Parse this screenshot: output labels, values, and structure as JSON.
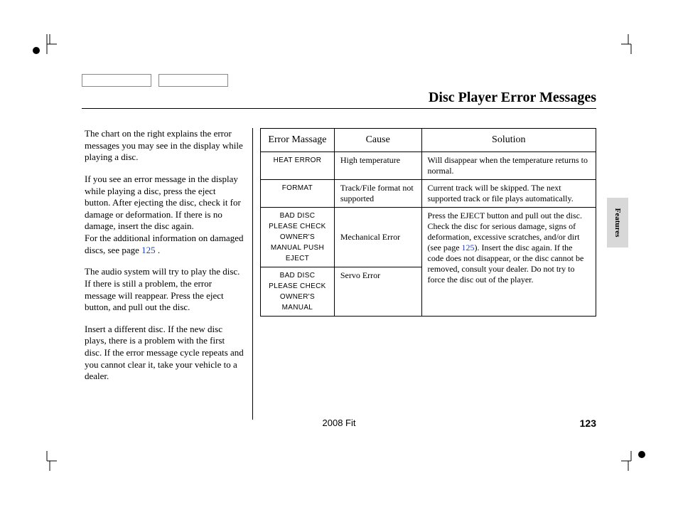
{
  "header": {
    "section_title": "Disc Player Error Messages"
  },
  "side_tab": {
    "label": "Features"
  },
  "footer": {
    "model": "2008  Fit",
    "page_number": "123"
  },
  "body": {
    "paragraphs": {
      "p1": "The chart on the right explains the error messages you may see in the display while playing a disc.",
      "p2a": "If you see an error message in the display while playing a disc, press the eject button. After ejecting the disc, check it for damage or deformation. If there is no damage, insert the disc again.",
      "p2b_prefix": "For the additional information on damaged discs, see page ",
      "p2b_link": "125",
      "p2b_suffix": " .",
      "p3": "The audio system will try to play the disc. If there is still a problem, the error message will reappear. Press the eject button, and pull out the disc.",
      "p4": "Insert a different disc. If the new disc plays, there is a problem with the first disc. If the error message cycle repeats and you cannot clear it, take your vehicle to a dealer."
    }
  },
  "table": {
    "headers": {
      "message": "Error Massage",
      "cause": "Cause",
      "solution": "Solution"
    },
    "rows": [
      {
        "message": "HEAT ERROR",
        "cause": "High temperature",
        "solution": "Will disappear when the temperature returns to normal."
      },
      {
        "message": "FORMAT",
        "cause": "Track/File format not supported",
        "solution": "Current track will be skipped. The next supported track or file plays automatically."
      }
    ],
    "shared": {
      "msg1": "BAD DISC PLEASE CHECK OWNER'S MANUAL PUSH EJECT",
      "cause1": "Mechanical Error",
      "msg2": "BAD DISC PLEASE CHECK OWNER'S MANUAL",
      "cause2": "Servo Error",
      "solution_a": "Press the EJECT button and pull out the disc. Check the disc for serious damage, signs of deformation, excessive scratches, and/or dirt (see page ",
      "solution_link": "125",
      "solution_b": "). Insert the disc again. If the code does not disappear, or the disc cannot be removed, consult your dealer. Do not try to force the disc out of the player."
    }
  }
}
